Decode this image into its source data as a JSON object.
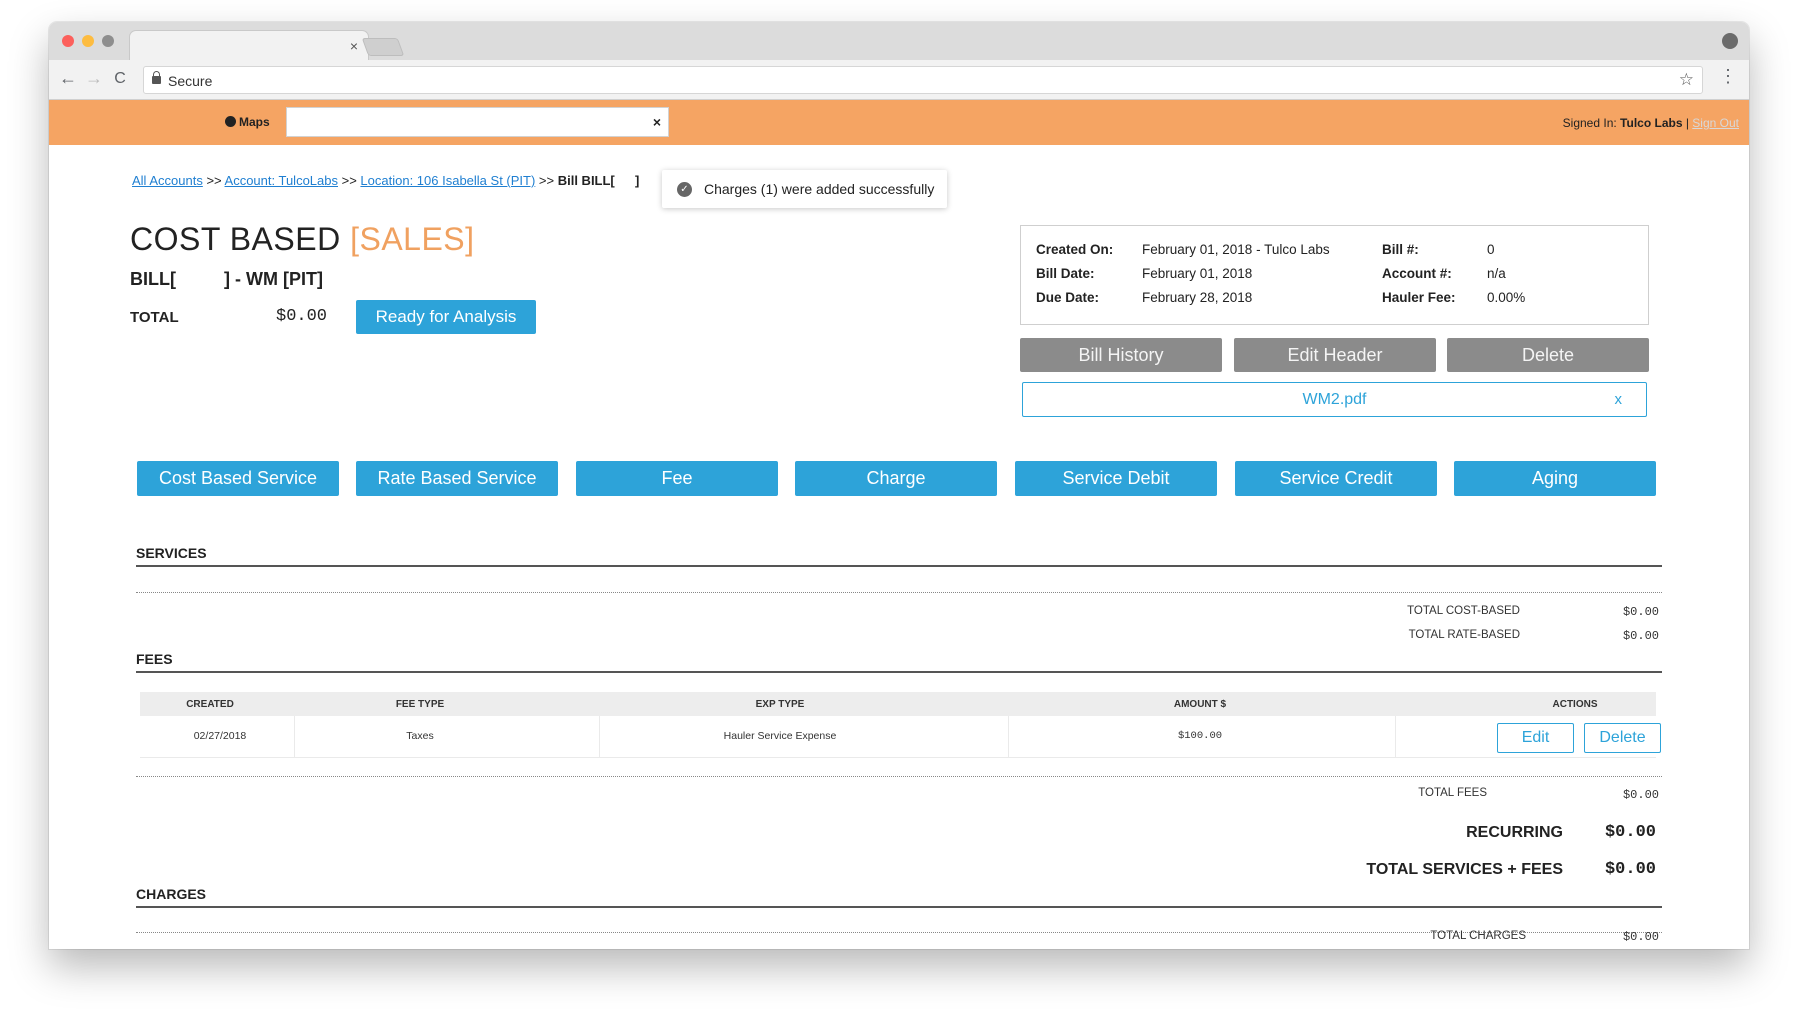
{
  "browser": {
    "tab_close": "×",
    "secure_label": "Secure",
    "back": "←",
    "forward": "→",
    "reload": "C",
    "star": "☆",
    "menu": "⋮"
  },
  "appbar": {
    "maps_label": "Maps",
    "search_value": "",
    "search_clear": "×",
    "signed_in_prefix": "Signed In:",
    "user_name": "Tulco Labs",
    "separator": " | ",
    "sign_out": "Sign Out",
    "bar_color": "#f5a463"
  },
  "breadcrumb": {
    "all_accounts": "All Accounts",
    "sep": " >> ",
    "account": "Account: TulcoLabs",
    "location": "Location: 106 Isabella St (PIT)",
    "current": "Bill BILL[",
    "current_close": "]"
  },
  "toast": {
    "icon": "✓",
    "message": "Charges (1) were added successfully"
  },
  "header": {
    "title_main": "COST BASED",
    "title_accent": "[SALES]",
    "bill_prefix": "BILL[",
    "bill_suffix": "] - WM [PIT]",
    "total_label": "TOTAL",
    "total_value": "$0.00",
    "status_button": "Ready for Analysis"
  },
  "info": {
    "created_on_label": "Created On:",
    "created_on_value": "February 01, 2018 - Tulco Labs",
    "bill_date_label": "Bill Date:",
    "bill_date_value": "February 01, 2018",
    "due_date_label": "Due Date:",
    "due_date_value": "February 28, 2018",
    "bill_no_label": "Bill #:",
    "bill_no_value": "0",
    "account_label": "Account #:",
    "account_value": "n/a",
    "hauler_fee_label": "Hauler Fee:",
    "hauler_fee_value": "0.00%"
  },
  "actions": {
    "bill_history": "Bill History",
    "edit_header": "Edit Header",
    "delete": "Delete",
    "attachment": "WM2.pdf",
    "attachment_remove": "x"
  },
  "add_buttons": [
    "Cost Based Service",
    "Rate Based Service",
    "Fee",
    "Charge",
    "Service Debit",
    "Service Credit",
    "Aging"
  ],
  "services": {
    "title": "SERVICES",
    "total_cost_label": "TOTAL COST-BASED",
    "total_cost_value": "$0.00",
    "total_rate_label": "TOTAL RATE-BASED",
    "total_rate_value": "$0.00"
  },
  "fees": {
    "title": "FEES",
    "columns": [
      "CREATED",
      "FEE TYPE",
      "EXP TYPE",
      "AMOUNT $",
      "ACTIONS"
    ],
    "rows": [
      {
        "created": "02/27/2018",
        "fee_type": "Taxes",
        "exp_type": "Hauler Service Expense",
        "amount": "$100.00",
        "edit": "Edit",
        "delete": "Delete"
      }
    ],
    "total_label": "TOTAL FEES",
    "total_value": "$0.00",
    "recurring_label": "RECURRING",
    "recurring_value": "$0.00",
    "total_sf_label": "TOTAL SERVICES + FEES",
    "total_sf_value": "$0.00"
  },
  "charges": {
    "title": "CHARGES",
    "total_label": "TOTAL CHARGES",
    "total_value": "$0.00"
  }
}
